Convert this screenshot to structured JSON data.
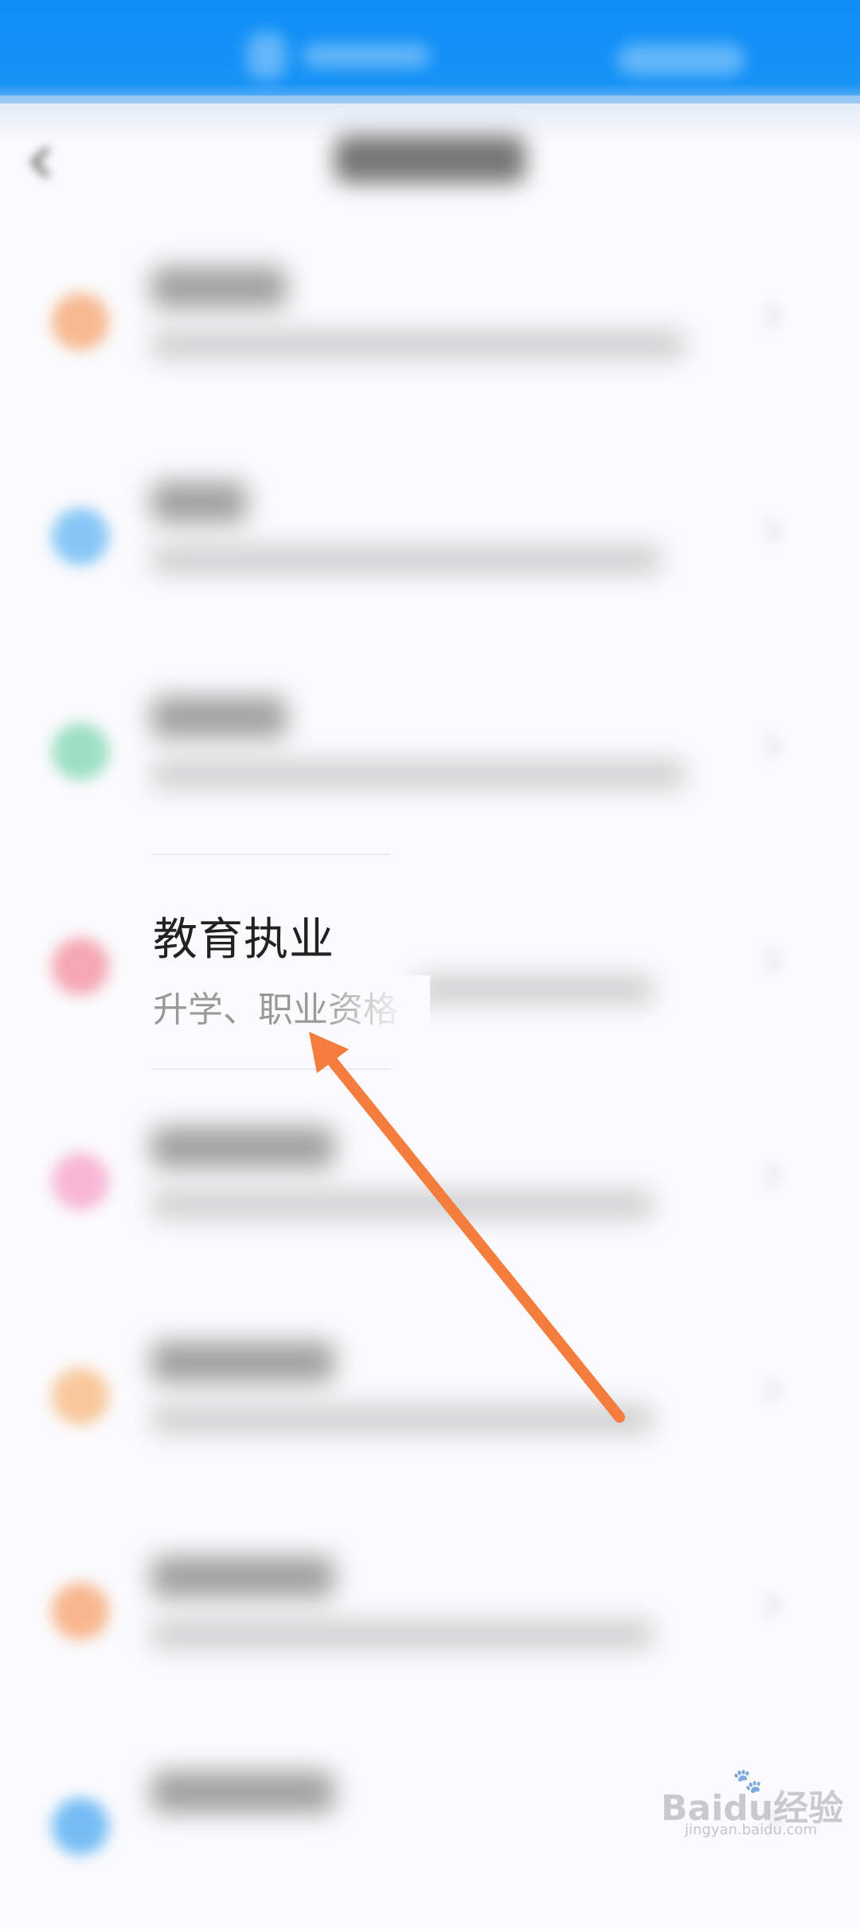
{
  "highlighted_item": {
    "title": "教育执业",
    "subtitle": "升学、职业资格"
  },
  "colors": {
    "topbar": "#0f8ef8",
    "arrow": "#f47c3c",
    "row_icons": [
      "#f6a36d",
      "#5fb4f3",
      "#7ed6b0",
      "#f38b9a",
      "#f7a0c8",
      "#f8b77d",
      "#f7a06b",
      "#4aa8f2"
    ]
  },
  "watermark": {
    "logo": "Baidu经验",
    "url": "jingyan.baidu.com"
  }
}
